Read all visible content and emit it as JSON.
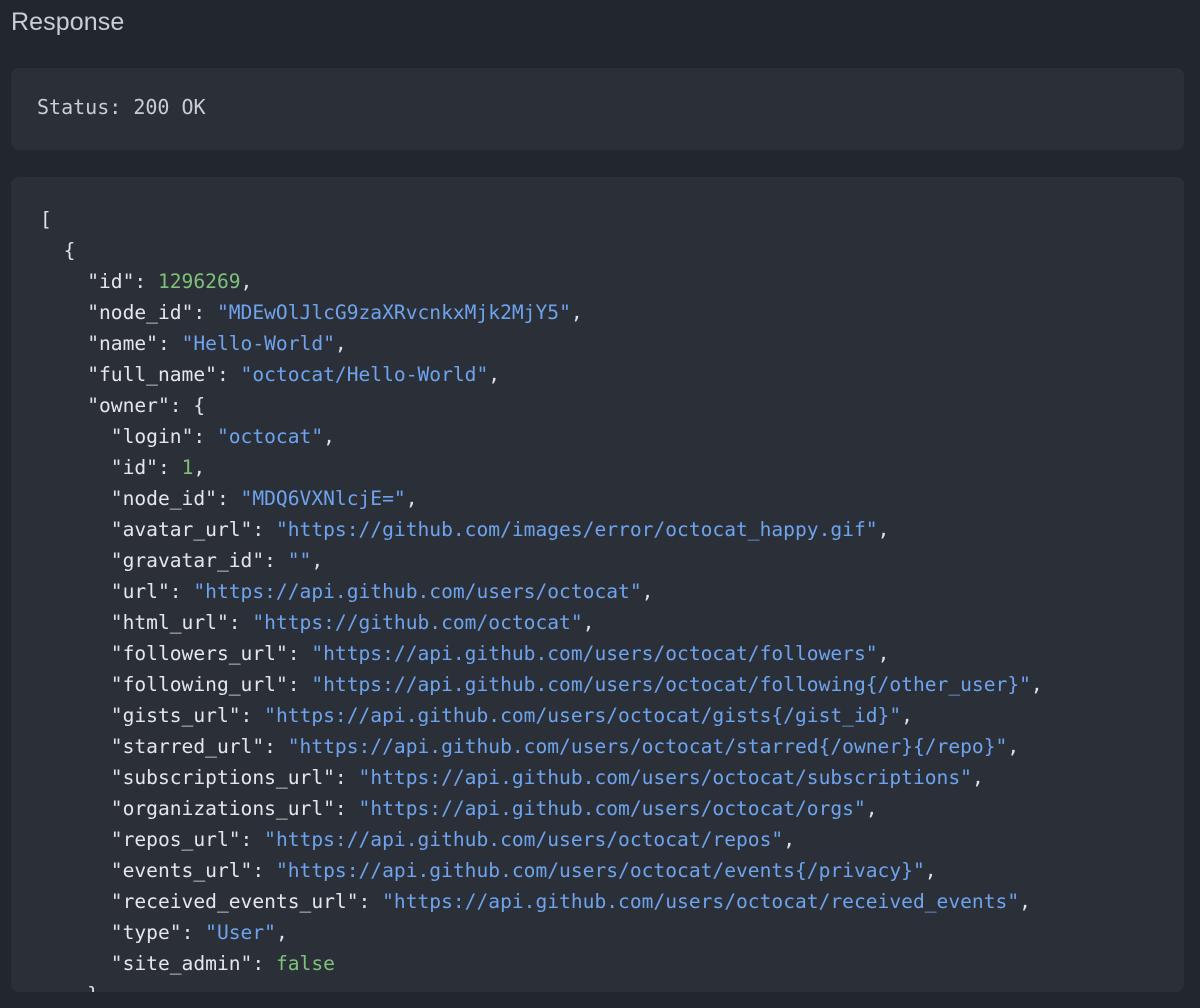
{
  "section": {
    "title": "Response"
  },
  "status": {
    "text": "Status: 200 OK"
  },
  "colors": {
    "background": "#22262d",
    "panel": "#2b3038",
    "string": "#6ea3ee",
    "number": "#7fc17a",
    "text": "#dfe2e7"
  },
  "json_lines": [
    {
      "indent": 0,
      "open": "["
    },
    {
      "indent": 1,
      "open": "{"
    },
    {
      "indent": 2,
      "key": "id",
      "value": "1296269",
      "vtype": "num",
      "comma": true
    },
    {
      "indent": 2,
      "key": "node_id",
      "value": "MDEwOlJlcG9zaXRvcnkxMjk2MjY5",
      "vtype": "str",
      "comma": true
    },
    {
      "indent": 2,
      "key": "name",
      "value": "Hello-World",
      "vtype": "str",
      "comma": true
    },
    {
      "indent": 2,
      "key": "full_name",
      "value": "octocat/Hello-World",
      "vtype": "str",
      "comma": true
    },
    {
      "indent": 2,
      "key": "owner",
      "value": "{",
      "vtype": "open",
      "comma": false
    },
    {
      "indent": 3,
      "key": "login",
      "value": "octocat",
      "vtype": "str",
      "comma": true
    },
    {
      "indent": 3,
      "key": "id",
      "value": "1",
      "vtype": "num",
      "comma": true
    },
    {
      "indent": 3,
      "key": "node_id",
      "value": "MDQ6VXNlcjE=",
      "vtype": "str",
      "comma": true
    },
    {
      "indent": 3,
      "key": "avatar_url",
      "value": "https://github.com/images/error/octocat_happy.gif",
      "vtype": "str",
      "comma": true
    },
    {
      "indent": 3,
      "key": "gravatar_id",
      "value": "",
      "vtype": "str",
      "comma": true
    },
    {
      "indent": 3,
      "key": "url",
      "value": "https://api.github.com/users/octocat",
      "vtype": "str",
      "comma": true
    },
    {
      "indent": 3,
      "key": "html_url",
      "value": "https://github.com/octocat",
      "vtype": "str",
      "comma": true
    },
    {
      "indent": 3,
      "key": "followers_url",
      "value": "https://api.github.com/users/octocat/followers",
      "vtype": "str",
      "comma": true
    },
    {
      "indent": 3,
      "key": "following_url",
      "value": "https://api.github.com/users/octocat/following{/other_user}",
      "vtype": "str",
      "comma": true
    },
    {
      "indent": 3,
      "key": "gists_url",
      "value": "https://api.github.com/users/octocat/gists{/gist_id}",
      "vtype": "str",
      "comma": true
    },
    {
      "indent": 3,
      "key": "starred_url",
      "value": "https://api.github.com/users/octocat/starred{/owner}{/repo}",
      "vtype": "str",
      "comma": true
    },
    {
      "indent": 3,
      "key": "subscriptions_url",
      "value": "https://api.github.com/users/octocat/subscriptions",
      "vtype": "str",
      "comma": true
    },
    {
      "indent": 3,
      "key": "organizations_url",
      "value": "https://api.github.com/users/octocat/orgs",
      "vtype": "str",
      "comma": true
    },
    {
      "indent": 3,
      "key": "repos_url",
      "value": "https://api.github.com/users/octocat/repos",
      "vtype": "str",
      "comma": true
    },
    {
      "indent": 3,
      "key": "events_url",
      "value": "https://api.github.com/users/octocat/events{/privacy}",
      "vtype": "str",
      "comma": true
    },
    {
      "indent": 3,
      "key": "received_events_url",
      "value": "https://api.github.com/users/octocat/received_events",
      "vtype": "str",
      "comma": true
    },
    {
      "indent": 3,
      "key": "type",
      "value": "User",
      "vtype": "str",
      "comma": true
    },
    {
      "indent": 3,
      "key": "site_admin",
      "value": "false",
      "vtype": "bool",
      "comma": false
    },
    {
      "indent": 2,
      "open": "},"
    }
  ]
}
